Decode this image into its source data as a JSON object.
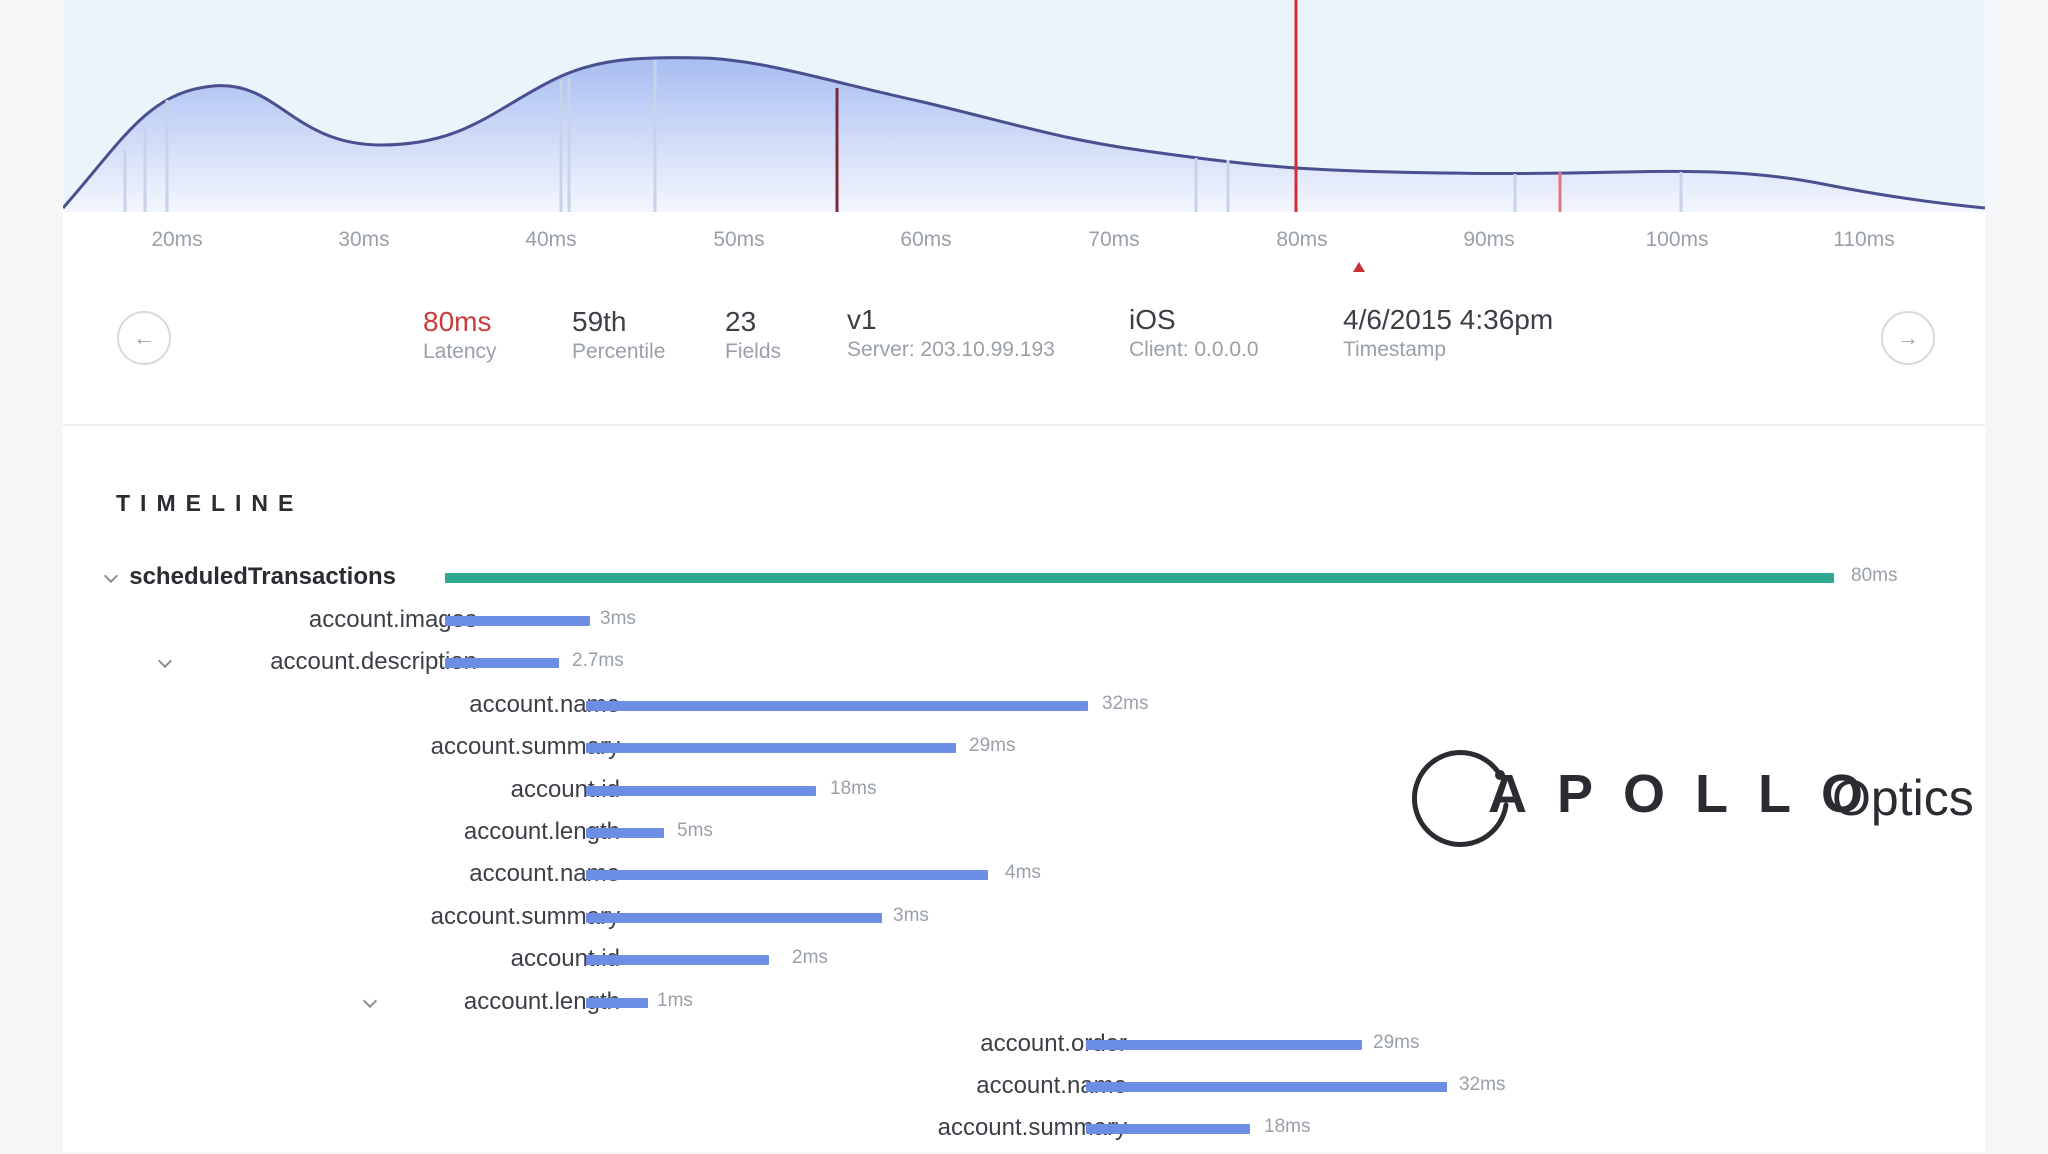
{
  "latency_chart": {
    "x_ticks": [
      "20ms",
      "30ms",
      "40ms",
      "50ms",
      "60ms",
      "70ms",
      "80ms",
      "90ms",
      "100ms",
      "110ms"
    ],
    "selected_tick": "80ms"
  },
  "summary": {
    "latency": {
      "value": "80ms",
      "label": "Latency",
      "color": "#cc3b3b"
    },
    "percentile": {
      "value": "59th",
      "label": "Percentile"
    },
    "fields": {
      "value": "23",
      "label": "Fields"
    },
    "server": {
      "value": "v1",
      "label": "Server: 203.10.99.193"
    },
    "client": {
      "value": "iOS",
      "label": "Client: 0.0.0.0"
    },
    "timestamp": {
      "value": "4/6/2015 4:36pm",
      "label": "Timestamp"
    }
  },
  "timeline": {
    "title": "TIMELINE",
    "rows": [
      {
        "name": "scheduledTransactions",
        "duration": "80ms",
        "expanded": true
      },
      {
        "name": "account.images",
        "duration": "3ms"
      },
      {
        "name": "account.description",
        "duration": "2.7ms",
        "expanded": true
      },
      {
        "name": "account.name",
        "duration": "32ms"
      },
      {
        "name": "account.summary",
        "duration": "29ms"
      },
      {
        "name": "account.id",
        "duration": "18ms"
      },
      {
        "name": "account.length",
        "duration": "5ms"
      },
      {
        "name": "account.name",
        "duration": "4ms"
      },
      {
        "name": "account.summary",
        "duration": "3ms"
      },
      {
        "name": "account.id",
        "duration": "2ms"
      },
      {
        "name": "account.length",
        "duration": "1ms",
        "expanded": true
      },
      {
        "name": "account.order",
        "duration": "29ms"
      },
      {
        "name": "account.name",
        "duration": "32ms"
      },
      {
        "name": "account.summary",
        "duration": "18ms"
      }
    ]
  },
  "logo": {
    "word": "APOLLO",
    "sub": "Optics"
  },
  "colors": {
    "accent_red": "#cc2f37",
    "root_bar": "#2ea891",
    "child_bar": "#6b8de3"
  },
  "icons": {
    "prev": "arrow-left-icon",
    "next": "arrow-right-icon",
    "expand": "chevron-down-icon"
  }
}
